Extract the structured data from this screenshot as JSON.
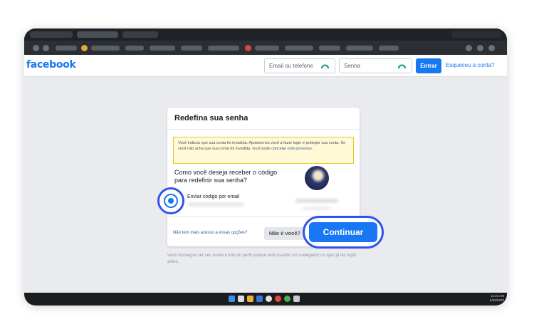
{
  "header": {
    "logo": "facebook",
    "email_placeholder": "Email ou telefone",
    "password_placeholder": "Senha",
    "login_button": "Entrar",
    "forgot_link": "Esqueceu a conta?"
  },
  "card": {
    "title": "Redefina sua senha",
    "warning_text": "Você indicou que sua conta foi invadida. Ajudaremos você a fazer login e proteger sua conta. Se você não acha que sua conta foi invadida, você pode",
    "warning_link": "cancelar este processo",
    "warning_end": ".",
    "question": "Como você deseja receber o código para redefinir sua senha?",
    "option_label": "Enviar código por email",
    "no_access_link": "Não tem mais acesso a essas opções?",
    "not_you_button": "Não é você?",
    "continue_button": "Continuar"
  },
  "footnote": "Você consegue ver seu nome e foto do perfil porque está usando um navegador no qual já fez login antes.",
  "taskbar": {
    "time": "11:23 AM",
    "date": "6/25/2023"
  },
  "colors": {
    "brand": "#1877f2",
    "highlight": "#2f54eb",
    "warning_bg": "#fff9d7"
  },
  "icons": [
    "password-manager-icon",
    "radio-selected-icon",
    "windows-start-icon"
  ]
}
